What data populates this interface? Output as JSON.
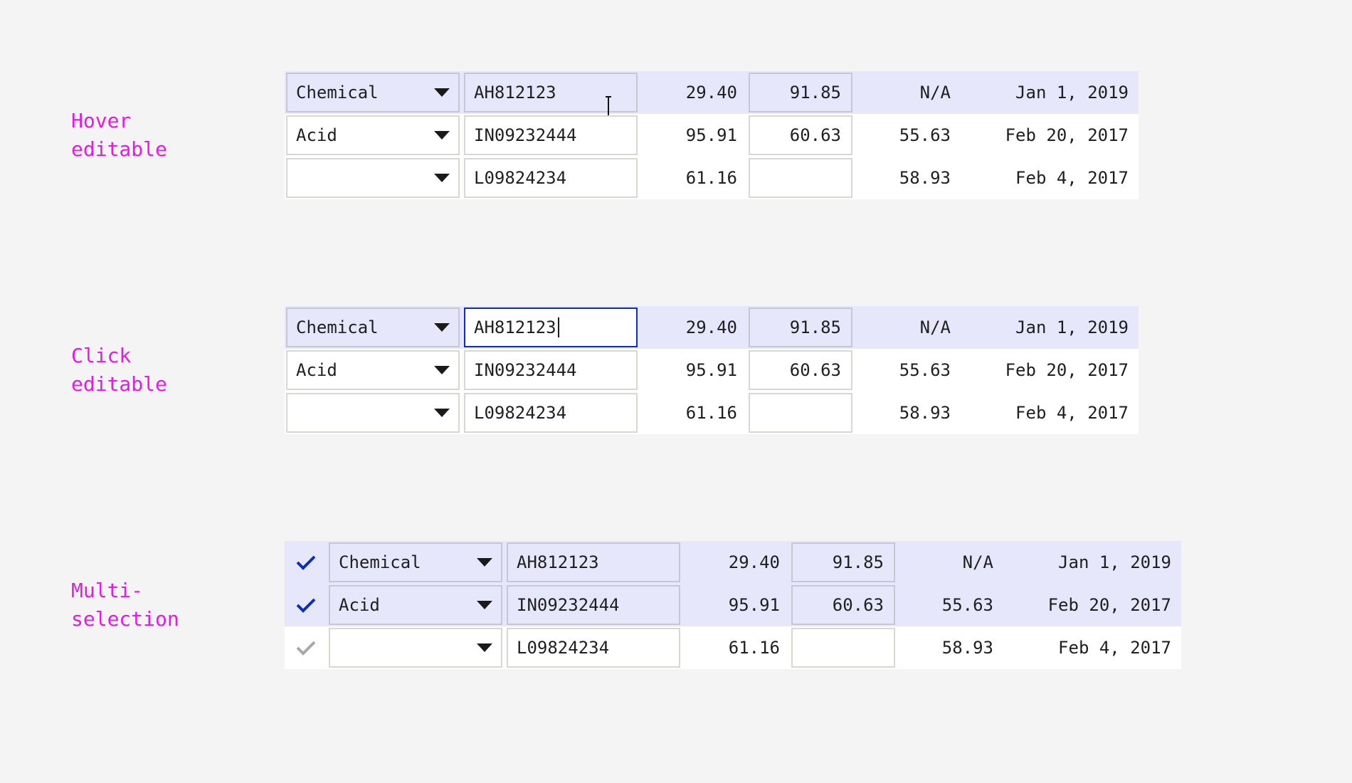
{
  "sections": [
    {
      "label": "Hover\neditable",
      "rows": [
        {
          "category": "Chemical",
          "code": "AH812123",
          "v1": "29.40",
          "v2": "91.85",
          "v3": "N/A",
          "date": "Jan 1, 2019"
        },
        {
          "category": "Acid",
          "code": "IN09232444",
          "v1": "95.91",
          "v2": "60.63",
          "v3": "55.63",
          "date": "Feb 20, 2017"
        },
        {
          "category": "",
          "code": "L09824234",
          "v1": "61.16",
          "v2": "",
          "v3": "58.93",
          "date": "Feb 4, 2017"
        }
      ]
    },
    {
      "label": "Click\neditable",
      "rows": [
        {
          "category": "Chemical",
          "code": "AH812123",
          "v1": "29.40",
          "v2": "91.85",
          "v3": "N/A",
          "date": "Jan 1, 2019"
        },
        {
          "category": "Acid",
          "code": "IN09232444",
          "v1": "95.91",
          "v2": "60.63",
          "v3": "55.63",
          "date": "Feb 20, 2017"
        },
        {
          "category": "",
          "code": "L09824234",
          "v1": "61.16",
          "v2": "",
          "v3": "58.93",
          "date": "Feb 4, 2017"
        }
      ]
    },
    {
      "label": "Multi-\nselection",
      "rows": [
        {
          "category": "Chemical",
          "code": "AH812123",
          "v1": "29.40",
          "v2": "91.85",
          "v3": "N/A",
          "date": "Jan 1, 2019"
        },
        {
          "category": "Acid",
          "code": "IN09232444",
          "v1": "95.91",
          "v2": "60.63",
          "v3": "55.63",
          "date": "Feb 20, 2017"
        },
        {
          "category": "",
          "code": "L09824234",
          "v1": "61.16",
          "v2": "",
          "v3": "58.93",
          "date": "Feb 4, 2017"
        }
      ]
    }
  ],
  "colors": {
    "label": "#e619e6",
    "highlight_row": "#e6e7fb",
    "focus_border": "#0d2fb3",
    "check_selected": "#0d2fb3",
    "check_unselected": "#a8a8a8"
  },
  "icons": {
    "dropdown": "chevron-down-icon",
    "check": "check-icon",
    "cursor": "text-cursor-icon"
  }
}
